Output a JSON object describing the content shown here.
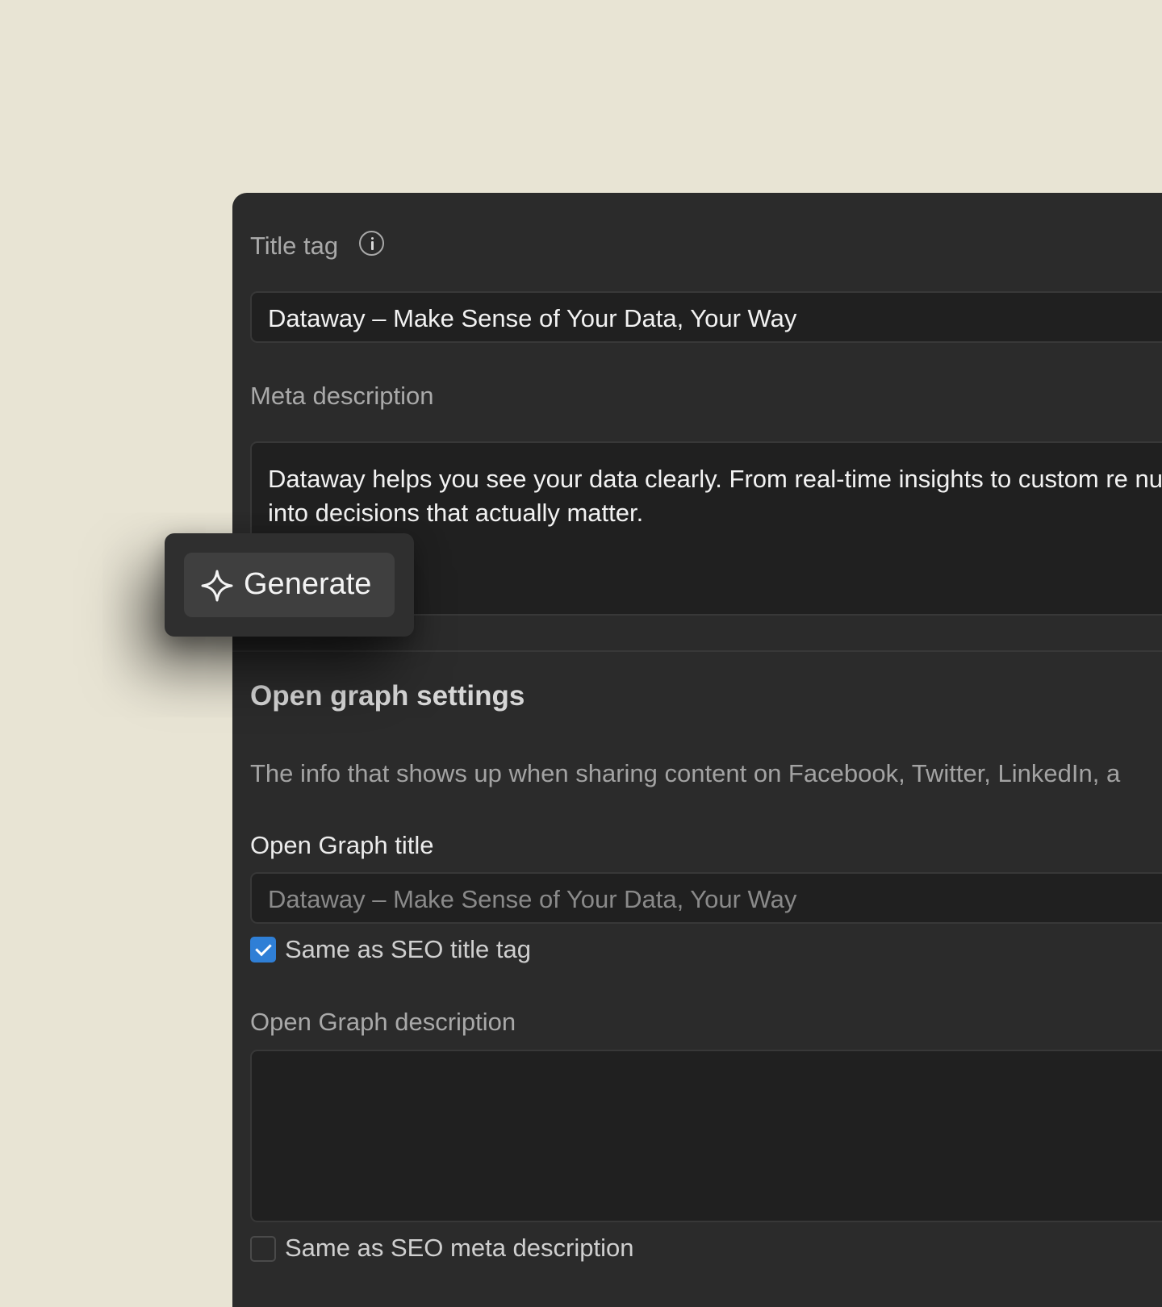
{
  "seo": {
    "title_tag_label": "Title tag",
    "title_tag_value": "Dataway – Make Sense of Your Data, Your Way",
    "meta_description_label": "Meta description",
    "meta_description_value": "Dataway helps you see your data clearly. From real-time insights to custom re numbers into decisions that actually matter."
  },
  "popover": {
    "generate_label": "Generate"
  },
  "open_graph": {
    "section_title": "Open graph settings",
    "helper_text": "The info that shows up when sharing content on Facebook, Twitter, LinkedIn, a",
    "title_label": "Open Graph title",
    "title_placeholder": "Dataway – Make Sense of Your Data, Your Way",
    "title_same_label": "Same as SEO title tag",
    "title_same_checked": true,
    "description_label": "Open Graph description",
    "description_value": "",
    "description_same_label": "Same as SEO meta description",
    "description_same_checked": false
  },
  "colors": {
    "page_background": "#e8e4d4",
    "panel_background": "#2b2b2b",
    "field_background": "#202020",
    "checkbox_accent": "#2f7fd6"
  },
  "icons": {
    "info": "info-circle-icon",
    "generate": "sparkle-icon",
    "check": "checkmark-icon"
  }
}
